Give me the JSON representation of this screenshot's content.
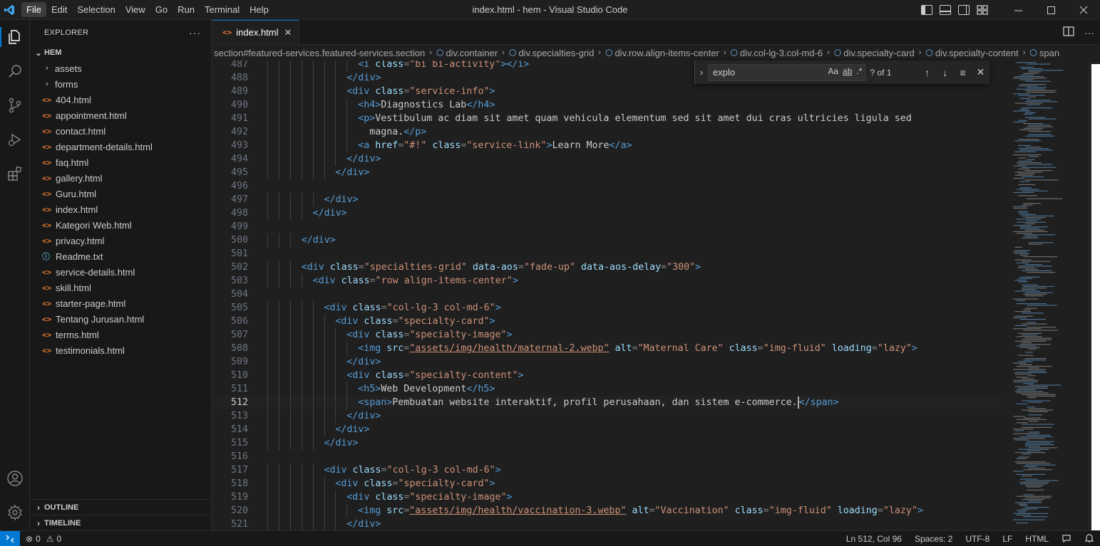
{
  "window": {
    "title": "index.html - hem - Visual Studio Code",
    "menu": [
      "File",
      "Edit",
      "Selection",
      "View",
      "Go",
      "Run",
      "Terminal",
      "Help"
    ],
    "active_menu": 0
  },
  "sidebar": {
    "header": "EXPLORER",
    "root": "HEM",
    "folders": [
      "assets",
      "forms"
    ],
    "files": [
      {
        "name": "404.html",
        "icon": "<>"
      },
      {
        "name": "appointment.html",
        "icon": "<>"
      },
      {
        "name": "contact.html",
        "icon": "<>"
      },
      {
        "name": "department-details.html",
        "icon": "<>"
      },
      {
        "name": "faq.html",
        "icon": "<>"
      },
      {
        "name": "gallery.html",
        "icon": "<>"
      },
      {
        "name": "Guru.html",
        "icon": "<>"
      },
      {
        "name": "index.html",
        "icon": "<>"
      },
      {
        "name": "Kategori Web.html",
        "icon": "<>"
      },
      {
        "name": "privacy.html",
        "icon": "<>"
      },
      {
        "name": "Readme.txt",
        "icon": "ⓘ"
      },
      {
        "name": "service-details.html",
        "icon": "<>"
      },
      {
        "name": "skill.html",
        "icon": "<>"
      },
      {
        "name": "starter-page.html",
        "icon": "<>"
      },
      {
        "name": "Tentang Jurusan.html",
        "icon": "<>"
      },
      {
        "name": "terms.html",
        "icon": "<>"
      },
      {
        "name": "testimonials.html",
        "icon": "<>"
      }
    ],
    "outline_label": "OUTLINE",
    "timeline_label": "TIMELINE"
  },
  "editor": {
    "tab": {
      "icon": "<>",
      "label": "index.html"
    },
    "breadcrumbs": [
      "section#featured-services.featured-services.section",
      "div.container",
      "div.specialties-grid",
      "div.row.align-items-center",
      "div.col-lg-3.col-md-6",
      "div.specialty-card",
      "div.specialty-content",
      "span"
    ],
    "current_line": 512,
    "lines": [
      {
        "n": "487",
        "indent": 8,
        "tokens": [
          [
            "tag",
            "<i "
          ],
          [
            "attr",
            "class"
          ],
          [
            "punc",
            "="
          ],
          [
            "str",
            "\"bi bi-activity\""
          ],
          [
            "tag",
            "></i>"
          ]
        ]
      },
      {
        "n": "488",
        "indent": 7,
        "tokens": [
          [
            "tag",
            "</div>"
          ]
        ]
      },
      {
        "n": "489",
        "indent": 7,
        "tokens": [
          [
            "tag",
            "<div "
          ],
          [
            "attr",
            "class"
          ],
          [
            "punc",
            "="
          ],
          [
            "str",
            "\"service-info\""
          ],
          [
            "tag",
            ">"
          ]
        ]
      },
      {
        "n": "490",
        "indent": 8,
        "tokens": [
          [
            "tag",
            "<h4>"
          ],
          [
            "text",
            "Diagnostics Lab"
          ],
          [
            "tag",
            "</h4>"
          ]
        ]
      },
      {
        "n": "491",
        "indent": 8,
        "tokens": [
          [
            "tag",
            "<p>"
          ],
          [
            "text",
            "Vestibulum ac diam sit amet quam vehicula elementum sed sit amet dui cras ultricies ligula sed"
          ]
        ]
      },
      {
        "n": "492",
        "indent": 8,
        "tokens": [
          [
            "text",
            "  magna."
          ],
          [
            "tag",
            "</p>"
          ]
        ]
      },
      {
        "n": "493",
        "indent": 8,
        "tokens": [
          [
            "tag",
            "<a "
          ],
          [
            "attr",
            "href"
          ],
          [
            "punc",
            "="
          ],
          [
            "str",
            "\"#!\""
          ],
          [
            "text",
            " "
          ],
          [
            "attr",
            "class"
          ],
          [
            "punc",
            "="
          ],
          [
            "str",
            "\"service-link\""
          ],
          [
            "tag",
            ">"
          ],
          [
            "text",
            "Learn More"
          ],
          [
            "tag",
            "</a>"
          ]
        ]
      },
      {
        "n": "494",
        "indent": 7,
        "tokens": [
          [
            "tag",
            "</div>"
          ]
        ]
      },
      {
        "n": "495",
        "indent": 6,
        "tokens": [
          [
            "tag",
            "</div>"
          ]
        ]
      },
      {
        "n": "496",
        "indent": 0,
        "tokens": []
      },
      {
        "n": "497",
        "indent": 5,
        "tokens": [
          [
            "tag",
            "</div>"
          ]
        ]
      },
      {
        "n": "498",
        "indent": 4,
        "tokens": [
          [
            "tag",
            "</div>"
          ]
        ]
      },
      {
        "n": "499",
        "indent": 0,
        "tokens": []
      },
      {
        "n": "500",
        "indent": 3,
        "tokens": [
          [
            "tag",
            "</div>"
          ]
        ]
      },
      {
        "n": "501",
        "indent": 0,
        "tokens": []
      },
      {
        "n": "502",
        "indent": 3,
        "tokens": [
          [
            "tag",
            "<div "
          ],
          [
            "attr",
            "class"
          ],
          [
            "punc",
            "="
          ],
          [
            "str",
            "\"specialties-grid\""
          ],
          [
            "text",
            " "
          ],
          [
            "attr",
            "data-aos"
          ],
          [
            "punc",
            "="
          ],
          [
            "str",
            "\"fade-up\""
          ],
          [
            "text",
            " "
          ],
          [
            "attr",
            "data-aos-delay"
          ],
          [
            "punc",
            "="
          ],
          [
            "str",
            "\"300\""
          ],
          [
            "tag",
            ">"
          ]
        ]
      },
      {
        "n": "503",
        "indent": 4,
        "tokens": [
          [
            "tag",
            "<div "
          ],
          [
            "attr",
            "class"
          ],
          [
            "punc",
            "="
          ],
          [
            "str",
            "\"row align-items-center\""
          ],
          [
            "tag",
            ">"
          ]
        ]
      },
      {
        "n": "504",
        "indent": 0,
        "tokens": []
      },
      {
        "n": "505",
        "indent": 5,
        "tokens": [
          [
            "tag",
            "<div "
          ],
          [
            "attr",
            "class"
          ],
          [
            "punc",
            "="
          ],
          [
            "str",
            "\"col-lg-3 col-md-6\""
          ],
          [
            "tag",
            ">"
          ]
        ]
      },
      {
        "n": "506",
        "indent": 6,
        "tokens": [
          [
            "tag",
            "<div "
          ],
          [
            "attr",
            "class"
          ],
          [
            "punc",
            "="
          ],
          [
            "str",
            "\"specialty-card\""
          ],
          [
            "tag",
            ">"
          ]
        ]
      },
      {
        "n": "507",
        "indent": 7,
        "tokens": [
          [
            "tag",
            "<div "
          ],
          [
            "attr",
            "class"
          ],
          [
            "punc",
            "="
          ],
          [
            "str",
            "\"specialty-image\""
          ],
          [
            "tag",
            ">"
          ]
        ]
      },
      {
        "n": "508",
        "indent": 8,
        "tokens": [
          [
            "tag",
            "<img "
          ],
          [
            "attr",
            "src"
          ],
          [
            "punc",
            "="
          ],
          [
            "url",
            "\"assets/img/health/maternal-2.webp\""
          ],
          [
            "text",
            " "
          ],
          [
            "attr",
            "alt"
          ],
          [
            "punc",
            "="
          ],
          [
            "str",
            "\"Maternal Care\""
          ],
          [
            "text",
            " "
          ],
          [
            "attr",
            "class"
          ],
          [
            "punc",
            "="
          ],
          [
            "str",
            "\"img-fluid\""
          ],
          [
            "text",
            " "
          ],
          [
            "attr",
            "loading"
          ],
          [
            "punc",
            "="
          ],
          [
            "str",
            "\"lazy\""
          ],
          [
            "tag",
            ">"
          ]
        ]
      },
      {
        "n": "509",
        "indent": 7,
        "tokens": [
          [
            "tag",
            "</div>"
          ]
        ]
      },
      {
        "n": "510",
        "indent": 7,
        "tokens": [
          [
            "tag",
            "<div "
          ],
          [
            "attr",
            "class"
          ],
          [
            "punc",
            "="
          ],
          [
            "str",
            "\"specialty-content\""
          ],
          [
            "tag",
            ">"
          ]
        ]
      },
      {
        "n": "511",
        "indent": 8,
        "tokens": [
          [
            "tag",
            "<h5>"
          ],
          [
            "text",
            "Web Development"
          ],
          [
            "tag",
            "</h5>"
          ]
        ]
      },
      {
        "n": "512",
        "indent": 8,
        "tokens": [
          [
            "tag",
            "<span>"
          ],
          [
            "text",
            "Pembuatan website interaktif, profil perusahaan, dan sistem e-commerce."
          ],
          [
            "cursor",
            ""
          ],
          [
            "tag",
            "</span>"
          ]
        ]
      },
      {
        "n": "513",
        "indent": 7,
        "tokens": [
          [
            "tag",
            "</div>"
          ]
        ]
      },
      {
        "n": "514",
        "indent": 6,
        "tokens": [
          [
            "tag",
            "</div>"
          ]
        ]
      },
      {
        "n": "515",
        "indent": 5,
        "tokens": [
          [
            "tag",
            "</div>"
          ]
        ]
      },
      {
        "n": "516",
        "indent": 0,
        "tokens": []
      },
      {
        "n": "517",
        "indent": 5,
        "tokens": [
          [
            "tag",
            "<div "
          ],
          [
            "attr",
            "class"
          ],
          [
            "punc",
            "="
          ],
          [
            "str",
            "\"col-lg-3 col-md-6\""
          ],
          [
            "tag",
            ">"
          ]
        ]
      },
      {
        "n": "518",
        "indent": 6,
        "tokens": [
          [
            "tag",
            "<div "
          ],
          [
            "attr",
            "class"
          ],
          [
            "punc",
            "="
          ],
          [
            "str",
            "\"specialty-card\""
          ],
          [
            "tag",
            ">"
          ]
        ]
      },
      {
        "n": "519",
        "indent": 7,
        "tokens": [
          [
            "tag",
            "<div "
          ],
          [
            "attr",
            "class"
          ],
          [
            "punc",
            "="
          ],
          [
            "str",
            "\"specialty-image\""
          ],
          [
            "tag",
            ">"
          ]
        ]
      },
      {
        "n": "520",
        "indent": 8,
        "tokens": [
          [
            "tag",
            "<img "
          ],
          [
            "attr",
            "src"
          ],
          [
            "punc",
            "="
          ],
          [
            "url",
            "\"assets/img/health/vaccination-3.webp\""
          ],
          [
            "text",
            " "
          ],
          [
            "attr",
            "alt"
          ],
          [
            "punc",
            "="
          ],
          [
            "str",
            "\"Vaccination\""
          ],
          [
            "text",
            " "
          ],
          [
            "attr",
            "class"
          ],
          [
            "punc",
            "="
          ],
          [
            "str",
            "\"img-fluid\""
          ],
          [
            "text",
            " "
          ],
          [
            "attr",
            "loading"
          ],
          [
            "punc",
            "="
          ],
          [
            "str",
            "\"lazy\""
          ],
          [
            "tag",
            ">"
          ]
        ]
      },
      {
        "n": "521",
        "indent": 7,
        "tokens": [
          [
            "tag",
            "</div>"
          ]
        ]
      }
    ]
  },
  "find": {
    "query": "explo",
    "match_case_label": "Aa",
    "whole_word_label": "ab",
    "regex_label": ".*",
    "result_count": "? of 1"
  },
  "statusbar": {
    "errors": "0",
    "warnings": "0",
    "position": "Ln 512, Col 96",
    "spaces": "Spaces: 2",
    "encoding": "UTF-8",
    "eol": "LF",
    "language": "HTML"
  },
  "colors": {
    "accent": "#0078d4",
    "tag": "#569cd6",
    "attribute": "#9cdcfe",
    "string": "#ce9178",
    "html_icon": "#e37933"
  }
}
